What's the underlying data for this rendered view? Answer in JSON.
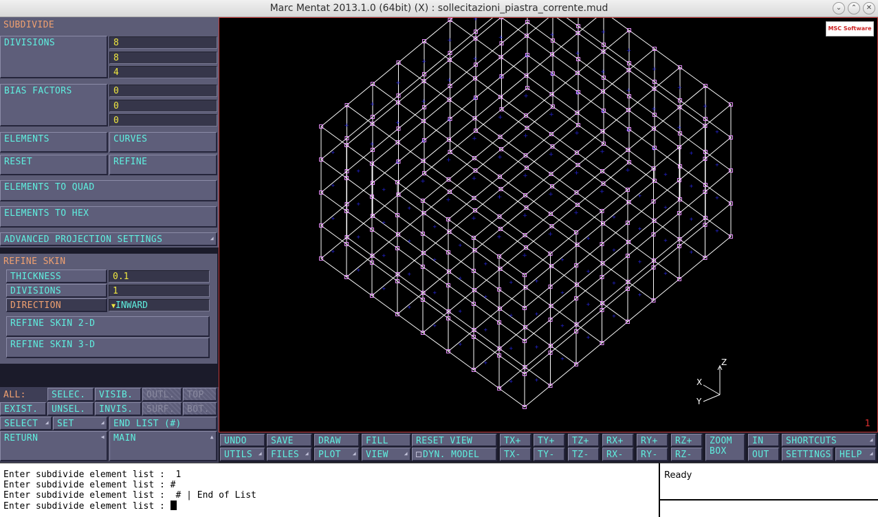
{
  "window": {
    "title": "Marc Mentat 2013.1.0 (64bit) (X) : sollecitazioni_piastra_corrente.mud"
  },
  "panel": {
    "header": "SUBDIVIDE",
    "divisions_label": "DIVISIONS",
    "divisions": [
      "8",
      "8",
      "4"
    ],
    "bias_label": "BIAS FACTORS",
    "bias": [
      "0",
      "0",
      "0"
    ],
    "elements": "ELEMENTS",
    "curves": "CURVES",
    "reset": "RESET",
    "refine": "REFINE",
    "to_quad": "ELEMENTS TO QUAD",
    "to_hex": "ELEMENTS TO HEX",
    "adv_proj": "ADVANCED PROJECTION SETTINGS",
    "refine_skin": {
      "header": "REFINE SKIN",
      "thickness_label": "THICKNESS",
      "thickness": "0.1",
      "divisions_label": "DIVISIONS",
      "divisions": "1",
      "direction_label": "DIRECTION",
      "direction": "INWARD",
      "skin2d": "REFINE SKIN 2-D",
      "skin3d": "REFINE SKIN 3-D"
    },
    "select": {
      "all": "ALL:",
      "selec": "SELEC.",
      "visib": "VISIB.",
      "outl": "OUTL.",
      "top": "TOP",
      "exist": "EXIST.",
      "unsel": "UNSEL.",
      "invis": "INVIS.",
      "surf": "SURF.",
      "bot": "BOT."
    },
    "select_btn": "SELECT",
    "set_btn": "SET",
    "end_list": "END LIST (#)",
    "return": "RETURN",
    "main": "MAIN"
  },
  "viewport": {
    "logo": "MSC Software",
    "number": "1",
    "axes": {
      "z": "Z",
      "x": "X",
      "y": "Y"
    }
  },
  "toolbar": {
    "row1": [
      "UNDO",
      "SAVE",
      "DRAW",
      "FILL",
      "RESET VIEW",
      "TX+",
      "TY+",
      "TZ+",
      "RX+",
      "RY+",
      "RZ+"
    ],
    "row2": [
      "UTILS",
      "FILES",
      "PLOT",
      "VIEW",
      "DYN. MODEL",
      "TX-",
      "TY-",
      "TZ-",
      "RX-",
      "RY-",
      "RZ-"
    ],
    "zoom_box": "ZOOM BOX",
    "in": "IN",
    "out": "OUT",
    "shortcuts": "SHORTCUTS",
    "settings": "SETTINGS",
    "help": "HELP"
  },
  "console": {
    "lines": [
      "Enter subdivide element list :  1",
      "Enter subdivide element list : #",
      "Enter subdivide element list :  # | End of List",
      "Enter subdivide element list : "
    ]
  },
  "status": "Ready",
  "colors": {
    "button_text": "#5ff0e0",
    "field_text": "#f0e840",
    "header_text": "#f0a070",
    "mesh_line": "#ffffff",
    "node": "#e890ff",
    "element_id": "#2222cc"
  }
}
